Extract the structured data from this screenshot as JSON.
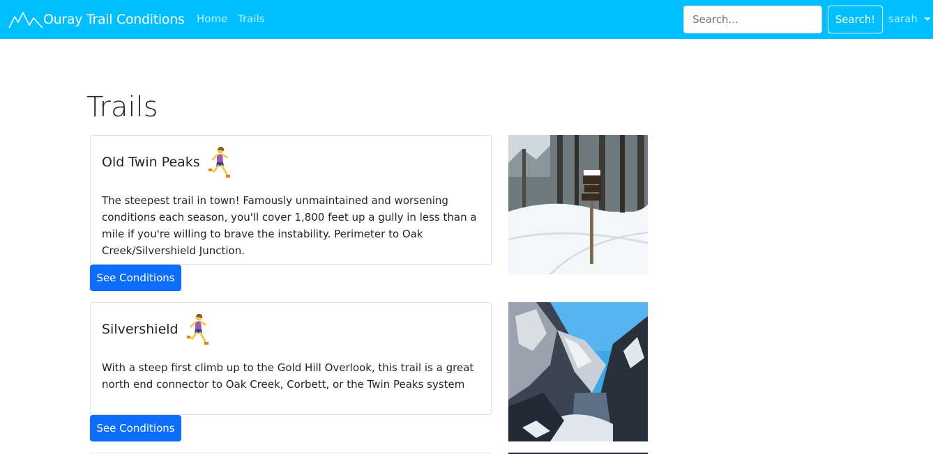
{
  "navbar": {
    "brand": "Ouray Trail Conditions",
    "links": [
      {
        "label": "Home"
      },
      {
        "label": "Trails"
      }
    ],
    "search": {
      "placeholder": "Search...",
      "value": ""
    },
    "search_button": "Search!",
    "user": "sarah",
    "colors": {
      "background": "#00bfff"
    }
  },
  "page": {
    "title": "Trails"
  },
  "trails": [
    {
      "name": "Old Twin Peaks",
      "icon": "woman-running-icon",
      "description": "The steepest trail in town! Famously unmaintained and worsening conditions each season, you'll cover 1,800 feet up a gully in less than a mile if you're willing to brave the instability. Perimeter to Oak Creek/Silvershield Junction.",
      "button": "See Conditions",
      "image": "snowy-forest-trail-sign"
    },
    {
      "name": "Silvershield",
      "icon": "woman-running-icon",
      "description": "With a steep first climb up to the Gold Hill Overlook, this trail is a great north end connector to Oak Creek, Corbett, or the Twin Peaks system",
      "button": "See Conditions",
      "image": "snowy-mountain-canyon"
    }
  ],
  "colors": {
    "primary_button": "#0d6efd",
    "card_border": "#dee2e6",
    "text": "#212529"
  }
}
